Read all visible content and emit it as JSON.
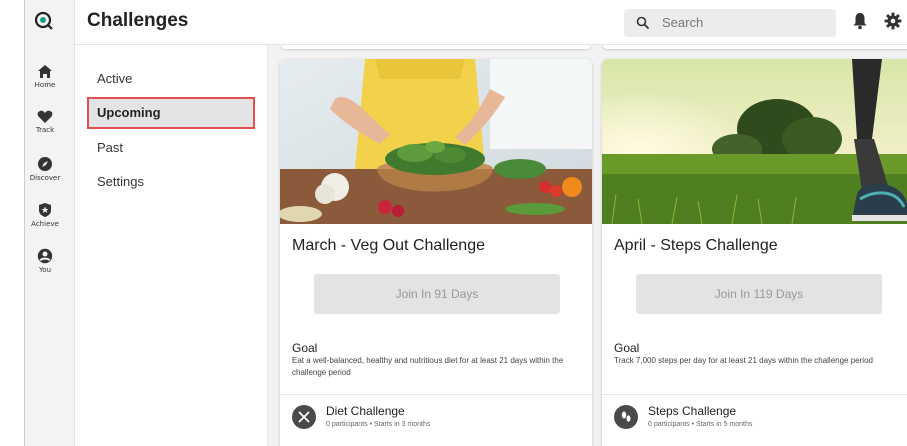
{
  "app": {
    "title": "Challenges",
    "search_placeholder": "Search"
  },
  "rail": {
    "items": [
      {
        "label": "Home",
        "icon": "home-icon"
      },
      {
        "label": "Track",
        "icon": "heart-icon"
      },
      {
        "label": "Discover",
        "icon": "compass-icon"
      },
      {
        "label": "Achieve",
        "icon": "shield-star-icon"
      },
      {
        "label": "You",
        "icon": "user-icon"
      }
    ]
  },
  "subnav": {
    "items": [
      {
        "label": "Active"
      },
      {
        "label": "Upcoming",
        "selected": true
      },
      {
        "label": "Past"
      },
      {
        "label": "Settings"
      }
    ]
  },
  "cards": [
    {
      "title": "March - Veg Out Challenge",
      "button": "Join In 91 Days",
      "goal_label": "Goal",
      "goal_text": "Eat a well-balanced, healthy and nutritious diet for at least 21 days within the challenge period",
      "type_name": "Diet Challenge",
      "type_meta": "0 participants  •  Starts in 3 months",
      "type_icon": "fork-knife-icon"
    },
    {
      "title": "April - Steps Challenge",
      "button": "Join In 119 Days",
      "goal_label": "Goal",
      "goal_text": "Track 7,000 steps per day for at least 21 days within the challenge period",
      "type_name": "Steps Challenge",
      "type_meta": "0 participants  •  Starts in 5 months",
      "type_icon": "footprints-icon"
    }
  ],
  "colors": {
    "accent": "#1a9e8a",
    "highlight_border": "#e05050",
    "rail_bg": "#f3f3f3",
    "content_bg": "#f2f2f2"
  }
}
